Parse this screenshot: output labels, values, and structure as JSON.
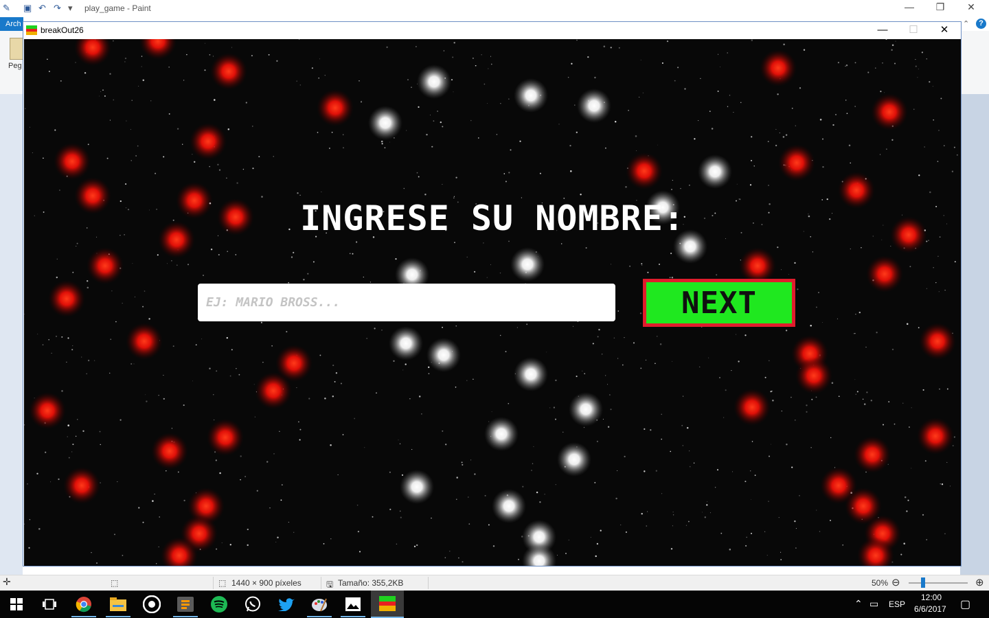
{
  "paint": {
    "window_title": "play_game - Paint",
    "file_tab": "Arch",
    "paste_label": "Peg",
    "help": "?"
  },
  "statusbar": {
    "dimensions": "1440 × 900 píxeles",
    "size": "Tamaño: 355,2KB",
    "zoom": "50%"
  },
  "game": {
    "window_title": "breakOut26",
    "prompt": "INGRESE SU NOMBRE:",
    "name_input": {
      "value": "",
      "placeholder": "EJ: MARIO BROSS..."
    },
    "next_label": "NEXT",
    "colors": {
      "button": "#1fe81f",
      "button_border": "#e01c2c",
      "red_orb": "#ff2a10",
      "white_orb": "#ffffff"
    }
  },
  "taskbar": {
    "apps": [
      "start-icon",
      "task-view-icon",
      "chrome-icon",
      "file-explorer-icon",
      "obs-icon",
      "sublime-icon",
      "spotify-icon",
      "whatsapp-icon",
      "twitter-icon",
      "paint-icon",
      "photos-icon",
      "breakout-icon"
    ],
    "language": "ESP",
    "time": "12:00",
    "date": "6/6/2017"
  }
}
